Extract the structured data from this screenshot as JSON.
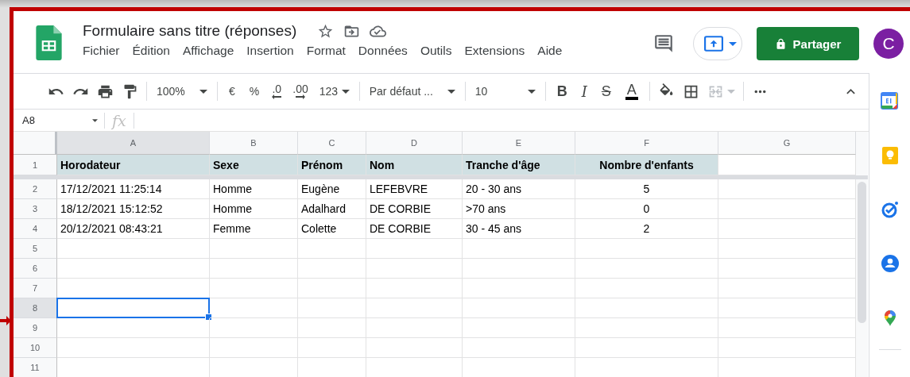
{
  "document": {
    "title": "Formulaire sans titre (réponses)"
  },
  "menu": [
    {
      "label": "Fichier"
    },
    {
      "label": "Édition"
    },
    {
      "label": "Affichage"
    },
    {
      "label": "Insertion"
    },
    {
      "label": "Format"
    },
    {
      "label": "Données"
    },
    {
      "label": "Outils"
    },
    {
      "label": "Extensions"
    },
    {
      "label": "Aide"
    }
  ],
  "share_button": {
    "label": "Partager"
  },
  "avatar": {
    "initial": "C"
  },
  "toolbar": {
    "zoom": "100%",
    "currency": "€",
    "percent": "%",
    "decrease_decimals": ".0",
    "increase_decimals": ".00",
    "number_format": "123",
    "font": "Par défaut ...",
    "font_size": "10",
    "bold": "B",
    "italic": "I",
    "strikethrough": "S",
    "text_color": "A"
  },
  "formula_bar": {
    "name_box": "A8",
    "function_label": "fx"
  },
  "columns": [
    {
      "label": "A",
      "kind": "text",
      "selected": true
    },
    {
      "label": "B",
      "kind": "text",
      "selected": false
    },
    {
      "label": "C",
      "kind": "text",
      "selected": false
    },
    {
      "label": "D",
      "kind": "text",
      "selected": false
    },
    {
      "label": "E",
      "kind": "text",
      "selected": false
    },
    {
      "label": "F",
      "kind": "number",
      "selected": false
    },
    {
      "label": "G",
      "kind": "text",
      "selected": false
    }
  ],
  "rows": [
    {
      "label": "1",
      "kind": "header",
      "selected": false,
      "cells": [
        "Horodateur",
        "Sexe",
        "Prénom",
        "Nom",
        "Tranche d'âge",
        "Nombre d'enfants"
      ]
    },
    {
      "label": "2",
      "kind": "data",
      "selected": false,
      "cells": [
        "17/12/2021 11:25:14",
        "Homme",
        "Eugène",
        "LEFEBVRE",
        "20 - 30 ans",
        "5"
      ]
    },
    {
      "label": "3",
      "kind": "data",
      "selected": false,
      "cells": [
        "18/12/2021 15:12:52",
        "Homme",
        "Adalhard",
        "DE CORBIE",
        ">70 ans",
        "0"
      ]
    },
    {
      "label": "4",
      "kind": "data",
      "selected": false,
      "cells": [
        "20/12/2021 08:43:21",
        "Femme",
        "Colette",
        "DE CORBIE",
        "30 - 45 ans",
        "2"
      ]
    },
    {
      "label": "5",
      "kind": "data",
      "selected": false
    },
    {
      "label": "6",
      "kind": "data",
      "selected": false
    },
    {
      "label": "7",
      "kind": "data",
      "selected": false
    },
    {
      "label": "8",
      "kind": "data",
      "selected": true
    },
    {
      "label": "9",
      "kind": "data",
      "selected": false
    },
    {
      "label": "10",
      "kind": "data",
      "selected": false
    },
    {
      "label": "11",
      "kind": "data",
      "selected": false
    }
  ]
}
